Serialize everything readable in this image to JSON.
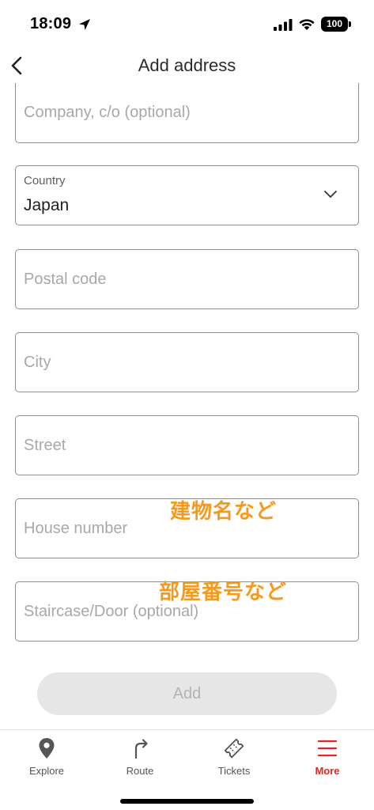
{
  "status_bar": {
    "time": "18:09",
    "battery": "100"
  },
  "header": {
    "title": "Add address"
  },
  "form": {
    "company_placeholder": "Company, c/o (optional)",
    "country_label": "Country",
    "country_value": "Japan",
    "postal_placeholder": "Postal code",
    "city_placeholder": "City",
    "street_placeholder": "Street",
    "house_placeholder": "House number",
    "staircase_placeholder": "Staircase/Door (optional)",
    "add_label": "Add"
  },
  "annotations": {
    "house_note": "建物名など",
    "staircase_note": "部屋番号など",
    "color": "#f59a1c"
  },
  "tab_bar": {
    "items": [
      {
        "label": "Explore",
        "icon": "location-pin-icon"
      },
      {
        "label": "Route",
        "icon": "route-arrow-icon"
      },
      {
        "label": "Tickets",
        "icon": "ticket-icon"
      },
      {
        "label": "More",
        "icon": "menu-icon"
      }
    ],
    "active_color": "#e52521"
  }
}
